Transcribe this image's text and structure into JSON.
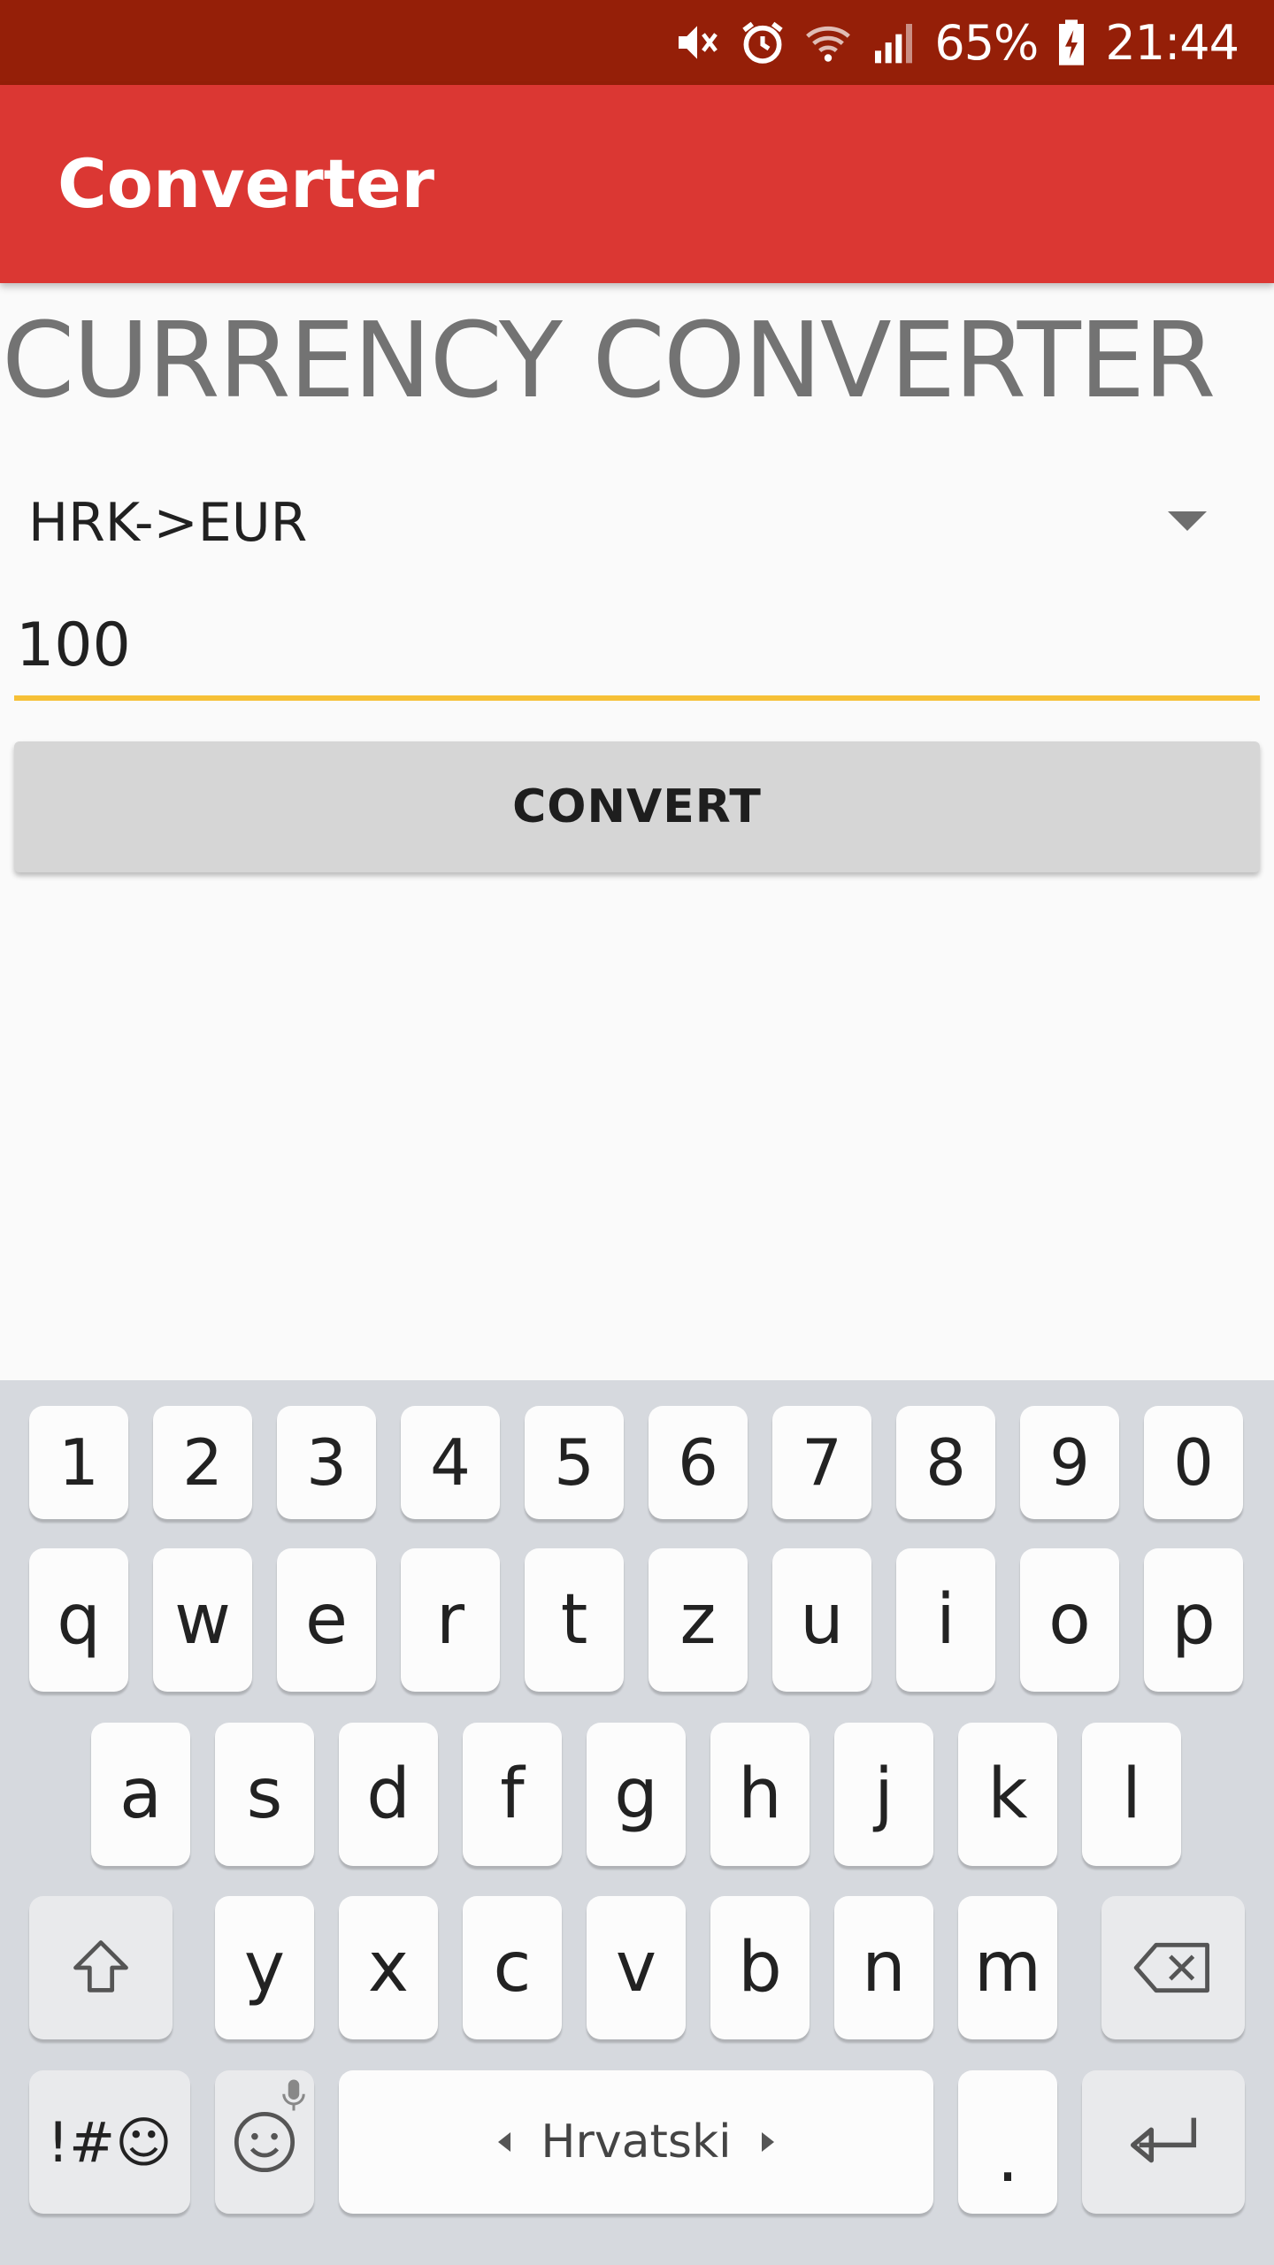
{
  "status_bar": {
    "battery_percent": "65%",
    "time": "21:44",
    "icons": [
      "mute-icon",
      "alarm-icon",
      "wifi-icon",
      "signal-icon",
      "battery-charging-icon"
    ]
  },
  "app_bar": {
    "title": "Converter"
  },
  "main": {
    "heading": "CURRENCY CONVERTER",
    "currency_select": {
      "value": "HRK->EUR"
    },
    "amount_input": {
      "value": "100"
    },
    "convert_button": {
      "label": "CONVERT"
    }
  },
  "keyboard": {
    "number_row": [
      "1",
      "2",
      "3",
      "4",
      "5",
      "6",
      "7",
      "8",
      "9",
      "0"
    ],
    "row1": [
      "q",
      "w",
      "e",
      "r",
      "t",
      "z",
      "u",
      "i",
      "o",
      "p"
    ],
    "row2": [
      "a",
      "s",
      "d",
      "f",
      "g",
      "h",
      "j",
      "k",
      "l"
    ],
    "row3": [
      "y",
      "x",
      "c",
      "v",
      "b",
      "n",
      "m"
    ],
    "symbols_key": "!#☺",
    "space_label": "Hrvatski",
    "period_key": ".",
    "icons": [
      "shift-icon",
      "backspace-icon",
      "emoji-icon",
      "mic-icon",
      "enter-icon"
    ]
  },
  "colors": {
    "status_bar": "#951f08",
    "app_bar": "#db3733",
    "accent_underline": "#f6c036",
    "button_bg": "#d6d6d6"
  }
}
